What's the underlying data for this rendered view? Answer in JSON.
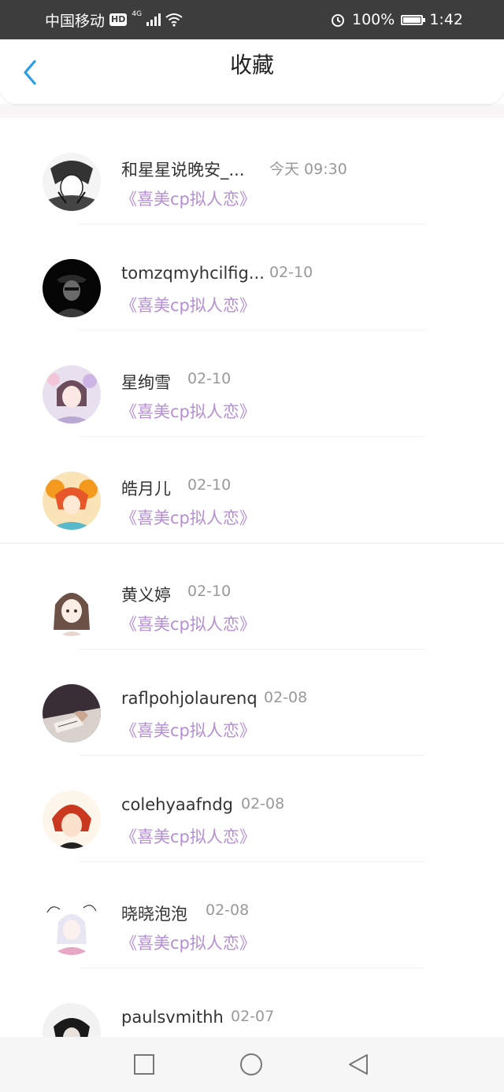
{
  "status_bar": {
    "carrier": "中国移动",
    "hd_badge": "HD",
    "network": "4G",
    "battery": "100%",
    "time": "1:42"
  },
  "header": {
    "title": "收藏",
    "back_icon": "chevron-left-icon",
    "accent_color": "#2a9de8"
  },
  "favorites": [
    {
      "name": "和星星说晚安_...",
      "time": "今天 09:30",
      "work": "《喜美cp拟人恋》"
    },
    {
      "name": "tomzqmyhcilfig...",
      "time": "02-10",
      "work": "《喜美cp拟人恋》"
    },
    {
      "name": "星绚雪",
      "time": "02-10",
      "work": "《喜美cp拟人恋》"
    },
    {
      "name": "皓月儿",
      "time": "02-10",
      "work": "《喜美cp拟人恋》"
    },
    {
      "name": "黄义婷",
      "time": "02-10",
      "work": "《喜美cp拟人恋》"
    },
    {
      "name": "raflpohjolaurenq",
      "time": "02-08",
      "work": "《喜美cp拟人恋》"
    },
    {
      "name": "colehyaafndg",
      "time": "02-08",
      "work": "《喜美cp拟人恋》"
    },
    {
      "name": "晓晓泡泡",
      "time": "02-08",
      "work": "《喜美cp拟人恋》"
    },
    {
      "name": "paulsvmithh",
      "time": "02-07",
      "work": ""
    }
  ],
  "work_color": "#b58ed4",
  "nav_bar": {
    "icons": [
      "recents-square-icon",
      "home-circle-icon",
      "back-triangle-icon"
    ]
  }
}
